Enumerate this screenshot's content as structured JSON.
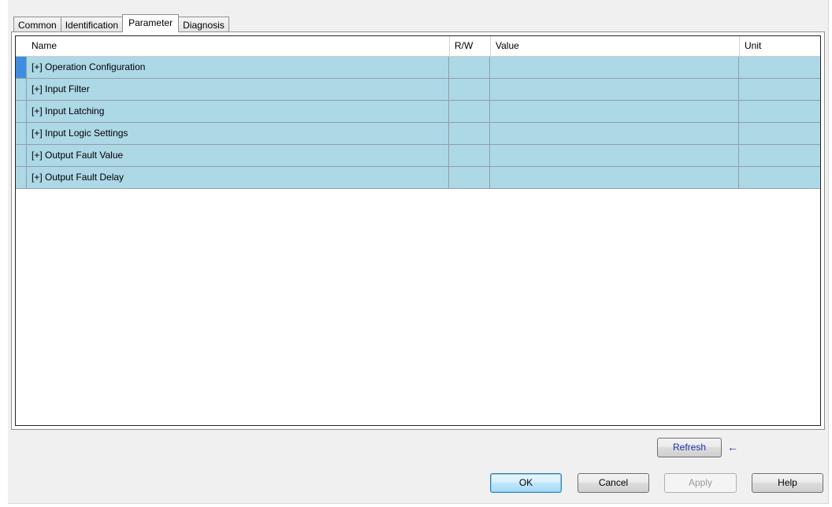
{
  "tabs": [
    {
      "label": "Common",
      "active": false
    },
    {
      "label": "Identification",
      "active": false
    },
    {
      "label": "Parameter",
      "active": true
    },
    {
      "label": "Diagnosis",
      "active": false
    }
  ],
  "grid": {
    "columns": {
      "name": "Name",
      "rw": "R/W",
      "value": "Value",
      "unit": "Unit"
    },
    "rows": [
      {
        "name": "[+] Operation Configuration",
        "rw": "",
        "value": "",
        "unit": ""
      },
      {
        "name": "[+] Input Filter",
        "rw": "",
        "value": "",
        "unit": ""
      },
      {
        "name": "[+] Input Latching",
        "rw": "",
        "value": "",
        "unit": ""
      },
      {
        "name": "[+] Input Logic Settings",
        "rw": "",
        "value": "",
        "unit": ""
      },
      {
        "name": "[+] Output Fault Value",
        "rw": "",
        "value": "",
        "unit": ""
      },
      {
        "name": "[+] Output Fault Delay",
        "rw": "",
        "value": "",
        "unit": ""
      }
    ],
    "row_color": "#add8e6",
    "current_row_indicator_color": "#3d8ee0"
  },
  "buttons": {
    "refresh": "Refresh",
    "refresh_arrow_icon": "left-arrow-icon",
    "ok": "OK",
    "cancel": "Cancel",
    "apply": "Apply",
    "help": "Help"
  }
}
